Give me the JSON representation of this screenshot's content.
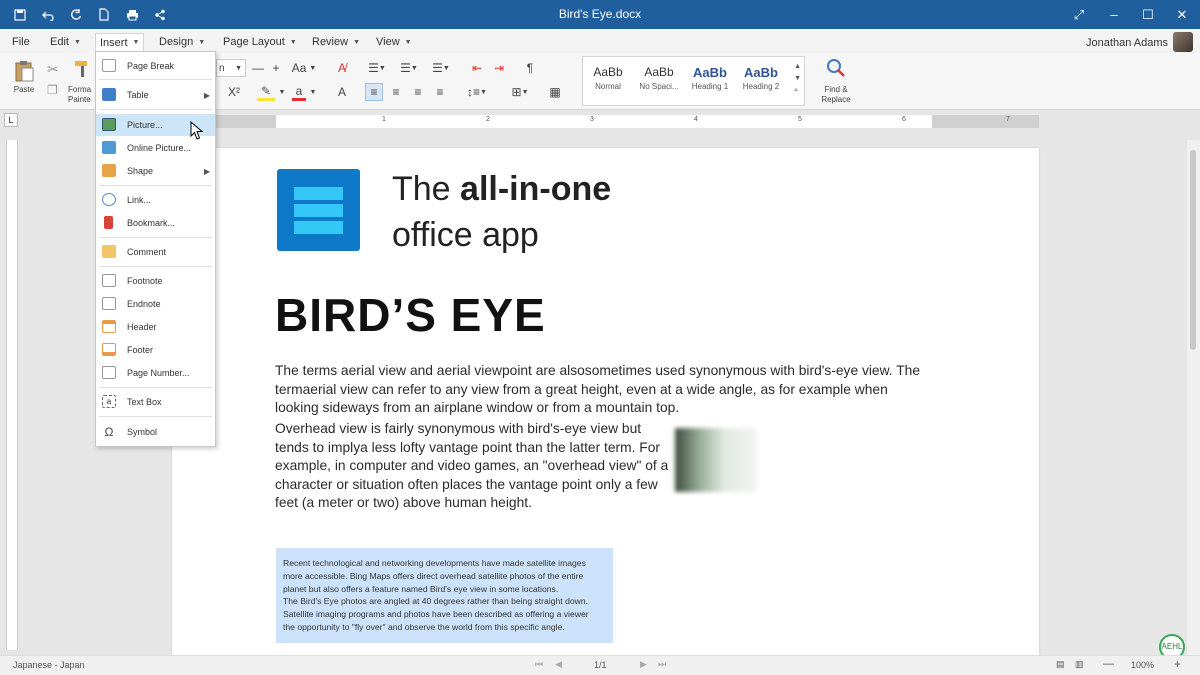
{
  "window": {
    "title": "Bird's Eye.docx"
  },
  "menubar": {
    "items": [
      {
        "label": "File"
      },
      {
        "label": "Edit"
      },
      {
        "label": "Insert"
      },
      {
        "label": "Design"
      },
      {
        "label": "Page Layout"
      },
      {
        "label": "Review"
      },
      {
        "label": "View"
      }
    ],
    "user_name": "Jonathan Adams"
  },
  "ribbon": {
    "paste_label": "Paste",
    "format_painter_label": "Forma\nPainte",
    "font_size_value": "n",
    "change_case_label": "Aa",
    "superscript_label": "X²",
    "font_color_label": "a",
    "text_effects_label": "A",
    "pilcrow_label": "¶",
    "styles": [
      {
        "sample": "AaBb",
        "name": "Normal"
      },
      {
        "sample": "AaBb",
        "name": "No Spaci..."
      },
      {
        "sample": "AaBb",
        "name": "Heading 1"
      },
      {
        "sample": "AaBb",
        "name": "Heading 2"
      }
    ],
    "find_replace_label": "Find &\nReplace"
  },
  "ruler": {
    "numbers": [
      "1",
      "2",
      "3",
      "4",
      "5",
      "6",
      "7"
    ]
  },
  "insert_menu": {
    "items": [
      {
        "label": "Page Break",
        "icon": "page-break-icon"
      },
      {
        "label": "Table",
        "icon": "table-icon",
        "submenu": true
      },
      {
        "label": "Picture...",
        "icon": "picture-icon",
        "hover": true
      },
      {
        "label": "Online Picture...",
        "icon": "online-picture-icon"
      },
      {
        "label": "Shape",
        "icon": "shape-icon",
        "submenu": true
      },
      {
        "label": "Link...",
        "icon": "link-icon"
      },
      {
        "label": "Bookmark...",
        "icon": "bookmark-icon"
      },
      {
        "label": "Comment",
        "icon": "comment-icon"
      },
      {
        "label": "Footnote",
        "icon": "footnote-icon"
      },
      {
        "label": "Endnote",
        "icon": "endnote-icon"
      },
      {
        "label": "Header",
        "icon": "header-icon"
      },
      {
        "label": "Footer",
        "icon": "footer-icon"
      },
      {
        "label": "Page Number...",
        "icon": "page-number-icon"
      },
      {
        "label": "Text Box",
        "icon": "text-box-icon"
      },
      {
        "label": "Symbol",
        "icon": "symbol-icon"
      }
    ]
  },
  "document": {
    "tagline_prefix": "The ",
    "tagline_bold": "all-in-one",
    "tagline_line2": "office app",
    "title": "BIRD’S EYE",
    "paragraph1": "The terms aerial view and aerial viewpoint are alsosometimes used synonymous with bird's-eye view. The termaerial view can refer to any view from a great height, even at a wide angle, as for example when looking sideways from an airplane window or from a mountain top.",
    "paragraph2": "Overhead view is fairly synonymous with bird's-eye view but tends to implya less lofty vantage point than the latter term. For example, in computer and video games, an \"overhead view\" of a character or situation often places the vantage point only a few feet (a meter or two) above human height.",
    "highlight_lines": [
      "Recent technological and networking developments have made satellite images",
      "more accessible. Bing Maps offers direct overhead satellite photos of the entire",
      "planet but also offers a feature named Bird's eye view in some locations.",
      "The Bird's Eye photos are angled at 40 degrees rather than being straight down.",
      "Satellite imaging programs and photos have been described as offering a viewer",
      "the opportunity to \"fly over\" and observe the world from this specific angle."
    ]
  },
  "statusbar": {
    "language": "Japanese - Japan",
    "page": "1/1",
    "zoom": "100%"
  },
  "colors": {
    "titlebar": "#1f5f9e",
    "logo": "#0e79c8",
    "logo_bars": "#33c8f6",
    "highlight": "#cde3fb",
    "menu_hover": "#cde6f7"
  }
}
